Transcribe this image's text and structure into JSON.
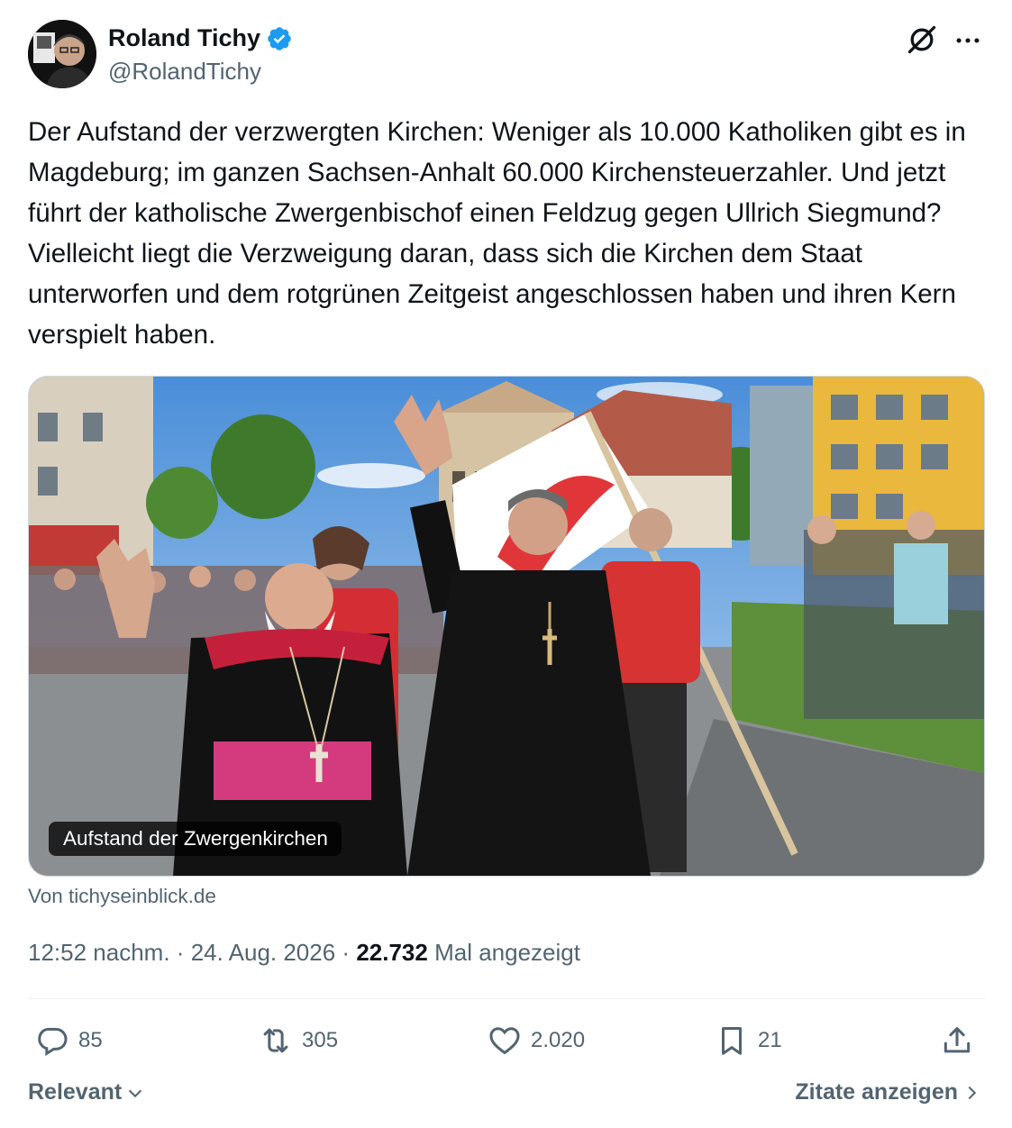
{
  "author": {
    "name": "Roland Tichy",
    "handle": "@RolandTichy",
    "verified": true
  },
  "tweet": {
    "text": "Der Aufstand der verzwergten Kirchen: Weniger als 10.000 Katholiken gibt es in Magdeburg; im ganzen Sachsen-Anhalt 60.000 Kirchensteuerzahler. Und jetzt führt der katholische Zwergenbischof einen Feldzug gegen Ullrich Siegmund? Vielleicht liegt die Verzweigung daran, dass sich die Kirchen dem Staat unterworfen und dem rotgrünen Zeitgeist angeschlossen haben und ihren Kern verspielt haben."
  },
  "media": {
    "caption": "Aufstand der Zwergenkirchen",
    "source": "Von tichyseinblick.de"
  },
  "meta": {
    "time": "12:52 nachm.",
    "separator": "·",
    "date": "24. Aug. 2026",
    "views_count": "22.732",
    "views_label": "Mal angezeigt"
  },
  "actions": {
    "replies": "85",
    "reposts": "305",
    "likes": "2.020",
    "bookmarks": "21"
  },
  "footer": {
    "sort_label": "Relevant",
    "quotes_label": "Zitate anzeigen"
  },
  "colors": {
    "text_primary": "#0f1419",
    "text_secondary": "#536471",
    "verified_blue": "#1d9bf0",
    "border": "#cfd9de"
  },
  "icons": [
    "grok-icon",
    "more-icon",
    "verified-icon",
    "reply-icon",
    "repost-icon",
    "like-icon",
    "bookmark-icon",
    "share-icon",
    "chevron-down-icon",
    "chevron-right-icon"
  ]
}
